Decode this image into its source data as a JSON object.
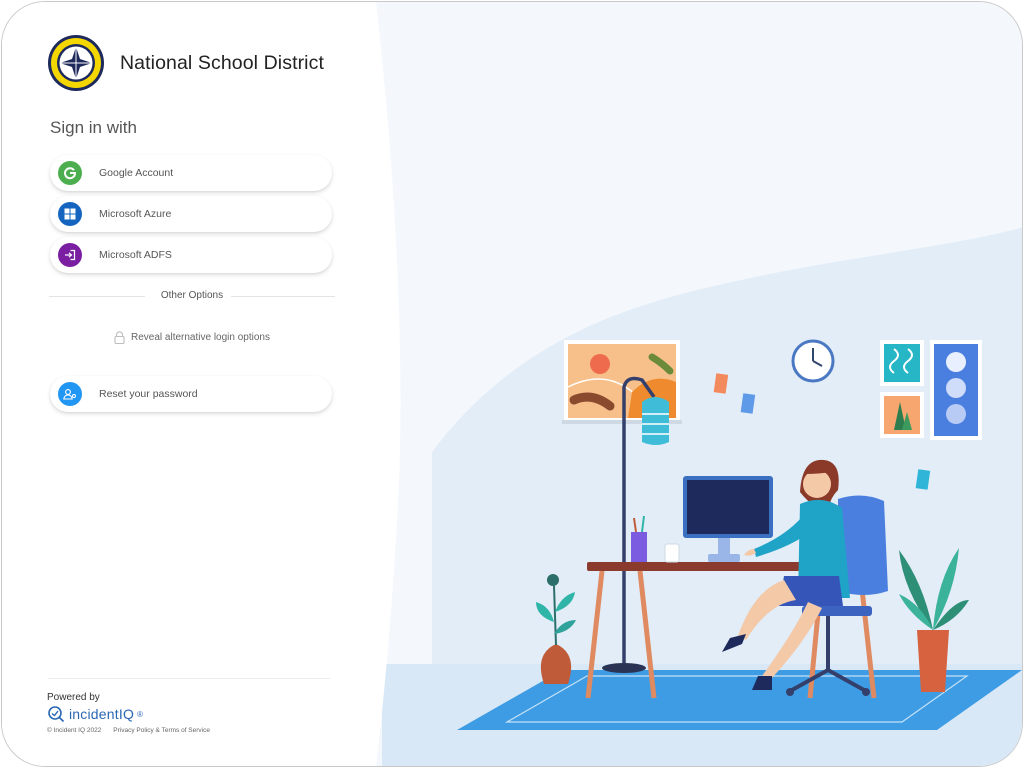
{
  "brand": {
    "district_name": "National School District",
    "logo_colors": {
      "ring": "#f4d700",
      "navy": "#1e2a5c"
    }
  },
  "signin": {
    "title": "Sign in with",
    "providers": [
      {
        "label": "Google Account",
        "icon": "google-icon",
        "color": "#4cae4f"
      },
      {
        "label": "Microsoft Azure",
        "icon": "windows-icon",
        "color": "#1565c0"
      },
      {
        "label": "Microsoft ADFS",
        "icon": "sign-in-icon",
        "color": "#7b1fa2"
      }
    ]
  },
  "other_options": {
    "divider_label": "Other Options",
    "reveal_label": "Reveal alternative login options",
    "reveal_icon": "lock-icon"
  },
  "reset": {
    "label": "Reset your password",
    "icon": "user-key-icon",
    "color": "#2196f3"
  },
  "footer": {
    "powered_by": "Powered by",
    "product_name": "incidentIQ",
    "registered_mark": "®",
    "copyright": "© Incident IQ 2022",
    "legal_links": "Privacy Policy & Terms of Service"
  },
  "colors": {
    "accent": "#2a67b3",
    "illustration_bg": "#eef4fb"
  }
}
